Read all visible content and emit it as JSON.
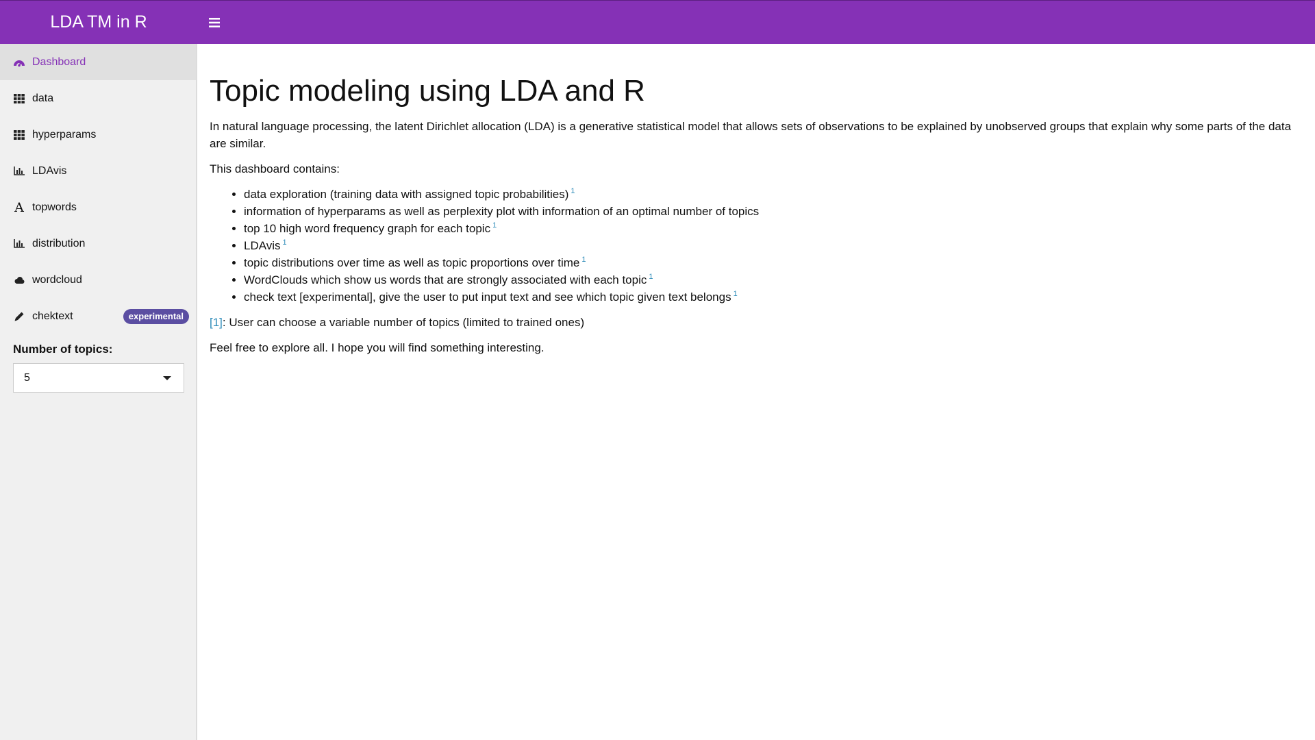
{
  "header": {
    "title": "LDA TM in R",
    "menu_toggle_icon": "hamburger-icon",
    "background_color": "#8531b6"
  },
  "sidebar": {
    "items": [
      {
        "label": "Dashboard",
        "icon": "tachometer-icon",
        "active": true
      },
      {
        "label": "data",
        "icon": "grid-icon"
      },
      {
        "label": "hyperparams",
        "icon": "grid-icon"
      },
      {
        "label": "LDAvis",
        "icon": "bar-chart-icon"
      },
      {
        "label": "topwords",
        "icon": "font-icon"
      },
      {
        "label": "distribution",
        "icon": "bar-chart-icon"
      },
      {
        "label": "wordcloud",
        "icon": "cloud-icon"
      },
      {
        "label": "chektext",
        "icon": "pencil-icon",
        "badge": "experimental"
      }
    ],
    "topics": {
      "label": "Number of topics:",
      "value": "5"
    }
  },
  "main": {
    "title": "Topic modeling using LDA and R",
    "intro": "In natural language processing, the latent Dirichlet allocation (LDA) is a generative statistical model that allows sets of observations to be explained by unobserved groups that explain why some parts of the data are similar.",
    "contains_label": "This dashboard contains:",
    "features": [
      {
        "text": "data exploration (training data with assigned topic probabilities)",
        "ref": "1"
      },
      {
        "text": "information of hyperparams as well as perplexity plot with information of an optimal number of topics",
        "ref": ""
      },
      {
        "text": "top 10 high word frequency graph for each topic",
        "ref": "1"
      },
      {
        "text": "LDAvis",
        "ref": "1"
      },
      {
        "text": "topic distributions over time as well as topic proportions over time",
        "ref": "1"
      },
      {
        "text": "WordClouds which show us words that are strongly associated with each topic",
        "ref": "1"
      },
      {
        "text": "check text [experimental], give the user to put input text and see which topic given text belongs",
        "ref": "1"
      }
    ],
    "footnote_ref": "[1]",
    "footnote_text": ": User can choose a variable number of topics (limited to trained ones)",
    "closing": "Feel free to explore all. I hope you will find something interesting."
  }
}
